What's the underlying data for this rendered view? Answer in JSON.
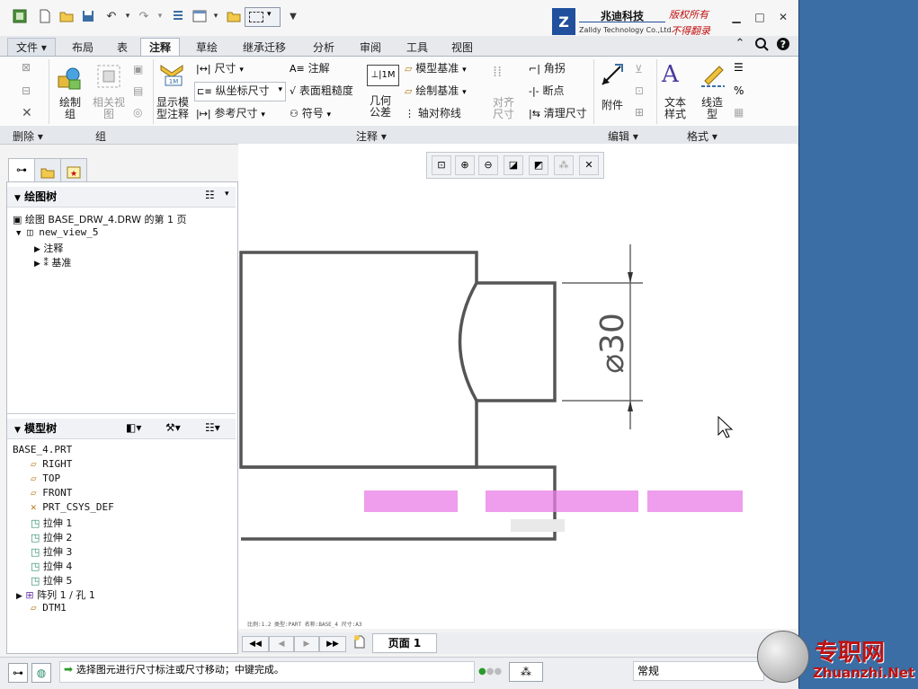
{
  "quick_access": {
    "icons": [
      "app-icon",
      "new-icon",
      "open-icon",
      "save-icon",
      "undo-icon",
      "redo-icon",
      "regenerate-icon",
      "window-icon",
      "folder-icon",
      "select-box-icon",
      "customize-icon"
    ]
  },
  "logo": {
    "mark": "Z",
    "cn": "兆迪科技",
    "en": "Zalldy Technology Co.,Ltd.",
    "red_line1": "版权所有",
    "red_line2": "不得翻录"
  },
  "tabs": [
    {
      "label": "文件 ▾"
    },
    {
      "label": "布局"
    },
    {
      "label": "表"
    },
    {
      "label": "注释"
    },
    {
      "label": "草绘"
    },
    {
      "label": "继承迁移"
    },
    {
      "label": "分析"
    },
    {
      "label": "审阅"
    },
    {
      "label": "工具"
    },
    {
      "label": "视图"
    }
  ],
  "ribbon": {
    "draw_group": "绘制\n组",
    "related_view": "相关视\n图",
    "show_model_annotation": "显示模\n型注释",
    "dimension": "尺寸",
    "ordinate_dimension": "纵坐标尺寸",
    "reference_dimension": "参考尺寸",
    "note": "注解",
    "surface_finish": "表面粗糙度",
    "symbol": "符号",
    "geometric_tolerance": "几何\n公差",
    "model_datum": "模型基准",
    "draw_datum": "绘制基准",
    "axis_symmetry": "轴对称线",
    "align_dimension": "对齐\n尺寸",
    "corner": "角拐",
    "breakpoint": "断点",
    "cleanup_dimension": "清理尺寸",
    "attachment": "附件",
    "text_style": "文本\n样式",
    "line_style": "线造\n型"
  },
  "groups": {
    "delete": "删除 ▾",
    "group": "组",
    "annotate": "注释 ▾",
    "edit": "编辑 ▾",
    "format": "格式 ▾"
  },
  "drawing_tree": {
    "title": "绘图树",
    "root": "绘图 BASE_DRW_4.DRW 的第 1 页",
    "view": "new_view_5",
    "children": [
      "注释",
      "基准"
    ]
  },
  "model_tree": {
    "title": "模型树",
    "items": [
      "BASE_4.PRT",
      "RIGHT",
      "TOP",
      "FRONT",
      "PRT_CSYS_DEF",
      "拉伸 1",
      "拉伸 2",
      "拉伸 3",
      "拉伸 4",
      "拉伸 5",
      "阵列 1 / 孔 1",
      "DTM1"
    ]
  },
  "drawing": {
    "dimension_text": "⌀30",
    "scale_text": "比例:1.2    类型:PART    名称:BASE_4    尺寸:A3"
  },
  "page_tab": "页面 1",
  "status": {
    "message": "选择图元进行尺寸标注或尺寸移动；中键完成。",
    "mode": "常规"
  },
  "watermark": {
    "cn": "专职网",
    "url": "Zhuanzhi.Net"
  }
}
